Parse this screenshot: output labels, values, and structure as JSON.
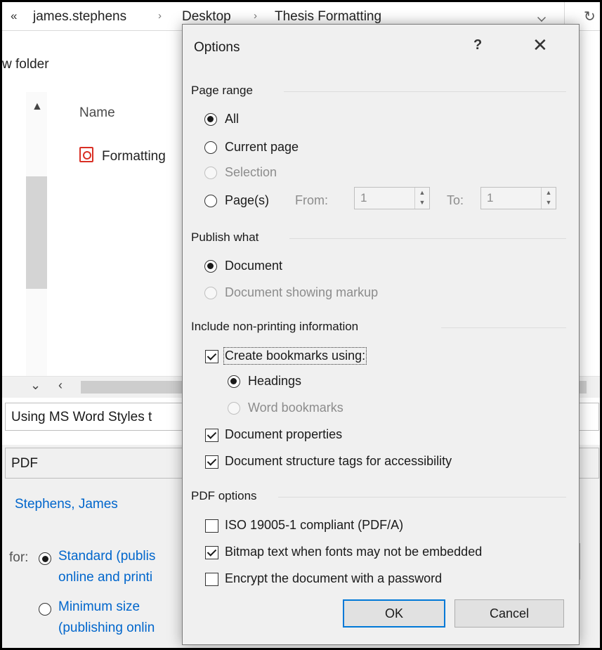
{
  "background": {
    "address": {
      "chevron": "«",
      "crumbs": [
        "james.stephens",
        "Desktop",
        "Thesis Formatting"
      ],
      "separator": "›",
      "refresh": "↻"
    },
    "toolbar": {
      "new_folder": "w folder"
    },
    "file_list": {
      "column_name": "Name",
      "file": "Formatting"
    },
    "filename_value": "Using MS Word Styles t",
    "save_type_value": "PDF",
    "authors_value": "Stephens, James",
    "optimize_for_label": "for:",
    "optimize_options": [
      {
        "line1": "Standard (publis",
        "line2": "online and printi",
        "selected": true
      },
      {
        "line1": "Minimum size",
        "line2": "(publishing onlin",
        "selected": false
      }
    ]
  },
  "dialog": {
    "title": "Options",
    "help": "?",
    "close": "✕",
    "page_range": {
      "label": "Page range",
      "all": "All",
      "current_page": "Current page",
      "selection": "Selection",
      "pages": "Page(s)",
      "from_label": "From:",
      "from_value": "1",
      "to_label": "To:",
      "to_value": "1"
    },
    "publish_what": {
      "label": "Publish what",
      "document": "Document",
      "document_markup": "Document showing markup"
    },
    "non_printing": {
      "label": "Include non-printing information",
      "create_bookmarks": "Create bookmarks using:",
      "headings": "Headings",
      "word_bookmarks": "Word bookmarks",
      "doc_properties": "Document properties",
      "structure_tags": "Document structure tags for accessibility"
    },
    "pdf_options": {
      "label": "PDF options",
      "iso": "ISO 19005-1 compliant (PDF/A)",
      "bitmap": "Bitmap text when fonts may not be embedded",
      "encrypt": "Encrypt the document with a password"
    },
    "buttons": {
      "ok": "OK",
      "cancel": "Cancel"
    }
  }
}
